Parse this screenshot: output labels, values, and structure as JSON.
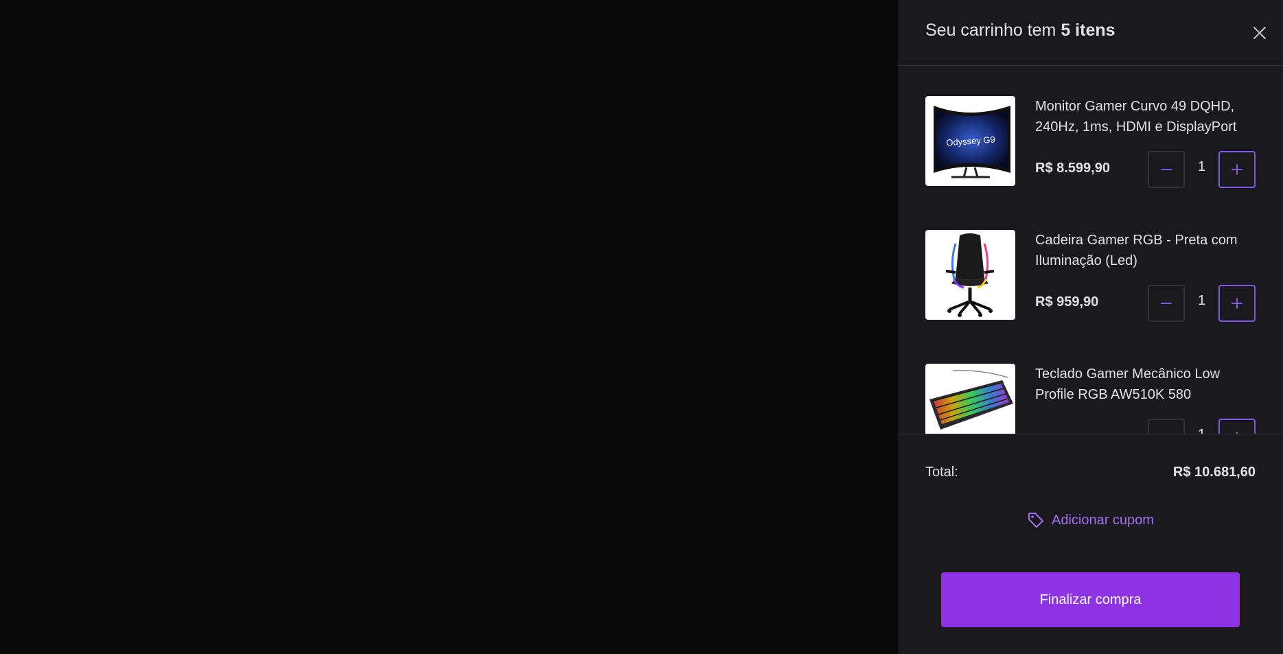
{
  "cart": {
    "title_prefix": "Seu carrinho tem",
    "title_count": "5 itens",
    "items": [
      {
        "name": "Monitor Gamer Curvo 49 DQHD, 240Hz, 1ms, HDMI e DisplayPort",
        "image_text": "Odyssey G9",
        "price": "R$ 8.599,90",
        "quantity": "1"
      },
      {
        "name": "Cadeira Gamer RGB - Preta com Iluminação (Led)",
        "price": "R$ 959,90",
        "quantity": "1"
      },
      {
        "name": "Teclado Gamer Mecânico Low Profile RGB AW510K 580",
        "price": "",
        "quantity": "1"
      }
    ],
    "total_label": "Total:",
    "total_value": "R$ 10.681,60",
    "coupon_label": "Adicionar cupom",
    "checkout_label": "Finalizar compra"
  },
  "icons": {
    "close": "close-icon",
    "minus": "minus-icon",
    "plus": "plus-icon",
    "coupon": "tag-icon"
  },
  "colors": {
    "backdrop": "#09090a",
    "drawer": "#1a1a1e",
    "accent": "#8257e5",
    "coupon": "#a46ef5",
    "checkout": "#8f33e6"
  }
}
